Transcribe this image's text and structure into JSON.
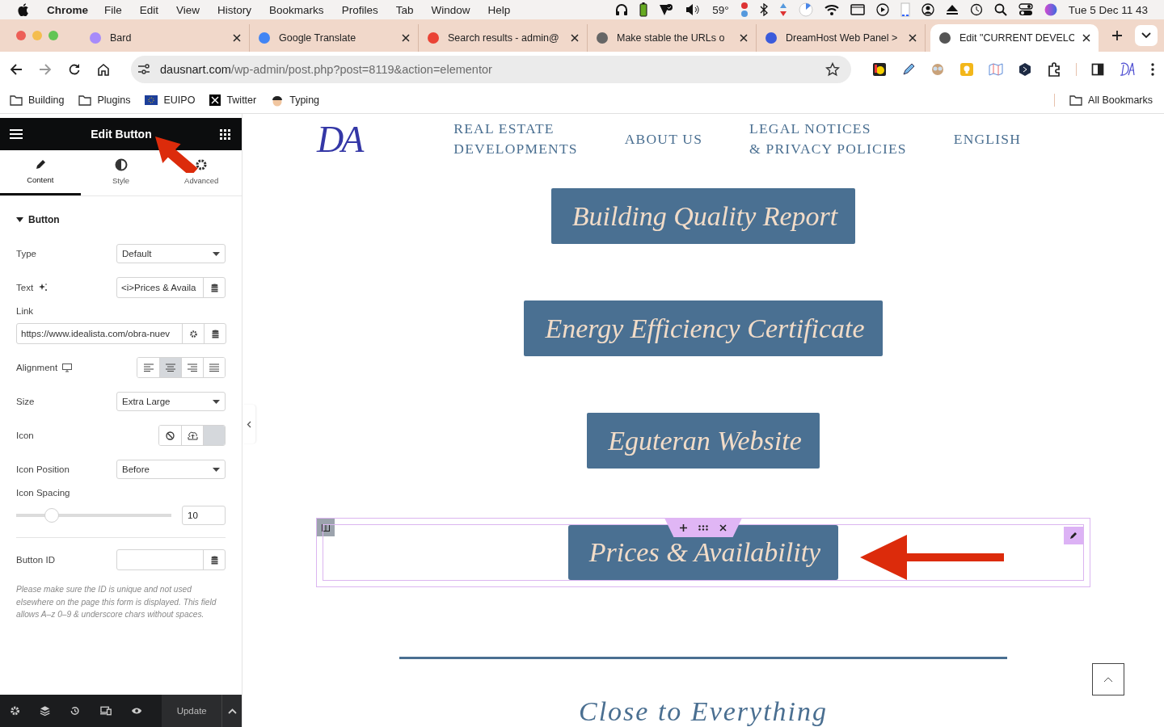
{
  "menu_bar": {
    "app": "Chrome",
    "menus": [
      "File",
      "Edit",
      "View",
      "History",
      "Bookmarks",
      "Profiles",
      "Tab",
      "Window",
      "Help"
    ],
    "temperature": "59°",
    "clock": "Tue 5 Dec  11 43"
  },
  "tabs": [
    {
      "title": "Bard",
      "selected": false
    },
    {
      "title": "Google Translate",
      "selected": false
    },
    {
      "title": "Search results - admin@",
      "selected": false
    },
    {
      "title": "Make stable the URLs o",
      "selected": false
    },
    {
      "title": "DreamHost Web Panel >",
      "selected": false
    },
    {
      "title": "Edit \"CURRENT DEVELC",
      "selected": true
    }
  ],
  "address": {
    "host": "dausnart.com",
    "path": "/wp-admin/post.php?post=8119&action=elementor"
  },
  "bookmarks": [
    {
      "label": "Building",
      "kind": "folder"
    },
    {
      "label": "Plugins",
      "kind": "folder"
    },
    {
      "label": "EUIPO",
      "kind": "flag"
    },
    {
      "label": "Twitter",
      "kind": "x"
    },
    {
      "label": "Typing",
      "kind": "avatar"
    }
  ],
  "all_bookmarks": "All Bookmarks",
  "panel": {
    "title": "Edit Button",
    "tabs": [
      {
        "label": "Content",
        "selected": true
      },
      {
        "label": "Style",
        "selected": false
      },
      {
        "label": "Advanced",
        "selected": false
      }
    ],
    "section": {
      "title": "Button",
      "expanded": true
    },
    "type": {
      "label": "Type",
      "value": "Default"
    },
    "text": {
      "label": "Text",
      "value": "<i>Prices & Availa"
    },
    "link": {
      "label": "Link",
      "value": "https://www.idealista.com/obra-nuev"
    },
    "alignment": {
      "label": "Alignment",
      "options": [
        {
          "kind": "left",
          "selected": false
        },
        {
          "kind": "center",
          "selected": true
        },
        {
          "kind": "right",
          "selected": false
        },
        {
          "kind": "justify",
          "selected": false
        }
      ]
    },
    "size": {
      "label": "Size",
      "value": "Extra Large"
    },
    "icon": {
      "label": "Icon"
    },
    "icon_position": {
      "label": "Icon Position",
      "value": "Before"
    },
    "icon_spacing": {
      "label": "Icon Spacing",
      "level": 0.2,
      "value": "10"
    },
    "button_id": {
      "label": "Button ID"
    },
    "help": "Please make sure the ID is unique and not used elsewhere on the page this form is displayed. This field allows A–z  0–9 & underscore chars without spaces.",
    "update": "Update"
  },
  "site": {
    "logo": "DA",
    "nav": [
      {
        "lines": [
          "REAL ESTATE",
          "DEVELOPMENTS"
        ]
      },
      {
        "lines": [
          "ABOUT US"
        ]
      },
      {
        "lines": [
          "LEGAL NOTICES",
          "& PRIVACY POLICIES"
        ]
      },
      {
        "lines": [
          "ENGLISH"
        ]
      }
    ],
    "buttons": [
      {
        "label": "Building Quality Report",
        "selected": false
      },
      {
        "label": "Energy Efficiency Certificate",
        "selected": false
      },
      {
        "label": "Eguteran Website",
        "selected": false
      },
      {
        "label": "Prices & Availability",
        "selected": true
      }
    ],
    "heading": "Close to Everything"
  }
}
